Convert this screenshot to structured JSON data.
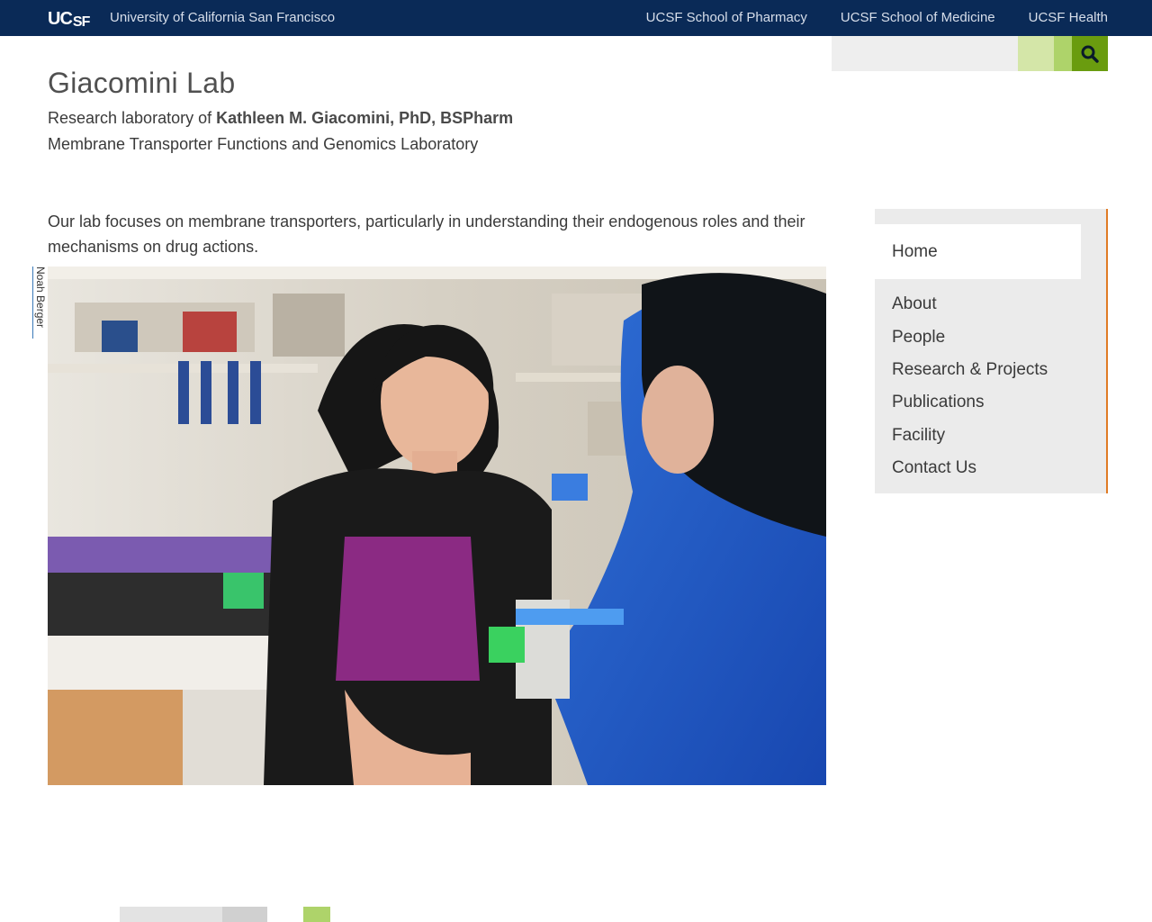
{
  "topbar": {
    "logo_uc": "UC",
    "logo_sf": "SF",
    "university": "University of California San Francisco",
    "links": [
      "UCSF School of Pharmacy",
      "UCSF School of Medicine",
      "UCSF Health"
    ]
  },
  "search": {
    "placeholder": "",
    "icon": "search-icon"
  },
  "header": {
    "title": "Giacomini Lab",
    "subtitle_prefix": "Research laboratory of ",
    "subtitle_name": "Kathleen M. Giacomini, PhD, BSPharm",
    "subtitle2": "Membrane Transporter Functions and Genomics Laboratory"
  },
  "main": {
    "intro": "Our lab focuses on membrane transporters, particularly in understanding their endogenous roles and their mechanisms on drug actions.",
    "photo_credit": "Noah Berger"
  },
  "sidebar": {
    "home": "Home",
    "items": [
      "About",
      "People",
      "Research & Projects",
      "Publications",
      "Facility",
      "Contact Us"
    ]
  },
  "colors": {
    "topbar": "#0a2a57",
    "accent_orange": "#e07b25",
    "search_green": "#6a9c0f"
  }
}
